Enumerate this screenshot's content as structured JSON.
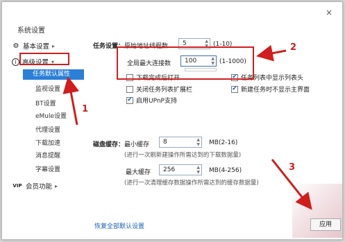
{
  "window": {
    "title": "系统设置",
    "close": "×"
  },
  "sidebar": {
    "groups": [
      {
        "label": "基本设置",
        "arrow": "▸",
        "icon": "gear-icon"
      },
      {
        "label": "高级设置",
        "arrow": "▾",
        "icon": "info-icon"
      },
      {
        "label": "会员功能",
        "arrow": "▸",
        "icon": "vip-icon"
      }
    ],
    "items": [
      {
        "label": "任务默认属性",
        "active": true
      },
      {
        "label": "监视设置"
      },
      {
        "label": "BT设置"
      },
      {
        "label": "eMule设置"
      },
      {
        "label": "代理设置"
      },
      {
        "label": "下载加速"
      },
      {
        "label": "消息提醒"
      },
      {
        "label": "字幕设置"
      }
    ],
    "vip_prefix": "VIP"
  },
  "task": {
    "section_label": "任务设置：",
    "threads_label": "原始地址线程数",
    "threads_value": "5",
    "threads_range": "(1-10)",
    "max_conn_label": "全局最大连接数",
    "max_conn_value": "100",
    "max_conn_range": "(1-1000)",
    "options": [
      {
        "label": "下载完成后打开",
        "checked": false
      },
      {
        "label": "任务列表中显示列表头",
        "checked": true
      },
      {
        "label": "关闭任务列表扩展栏",
        "checked": false
      },
      {
        "label": "新建任务时不显示主界面",
        "checked": true
      },
      {
        "label": "启用UPnP支持",
        "checked": true
      }
    ]
  },
  "disk": {
    "section_label": "磁盘缓存：",
    "min_label": "最小缓存",
    "min_value": "8",
    "min_unit": "MB(2-16)",
    "min_hint": "(进行一次刷新建操作所需达到的下载数据量)",
    "max_label": "最大缓存",
    "max_value": "256",
    "max_unit": "MB(4-256)",
    "max_hint": "(进行一次清理缓存数据操作所需达到的缓存数据量)"
  },
  "footer": {
    "restore": "恢复全部默认设置",
    "apply": "应用"
  },
  "annotations": {
    "n1": "1",
    "n2": "2",
    "n3": "3",
    "accent": "#d21d1d"
  }
}
